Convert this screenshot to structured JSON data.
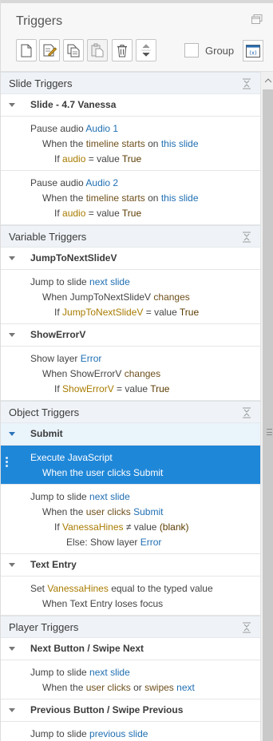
{
  "panel": {
    "title": "Triggers",
    "group_label": "Group"
  },
  "icons": {
    "toolbar": [
      "new-trigger-icon",
      "edit-trigger-icon",
      "copy-icon",
      "paste-icon",
      "delete-icon",
      "move-up-down-icon"
    ],
    "variables": "variables-icon",
    "restore": "restore-window-icon",
    "collapse": "collapse-all-icon"
  },
  "sections": [
    {
      "label": "Slide Triggers",
      "objects": [
        {
          "label": "Slide - 4.7 Vanessa",
          "triggers": [
            {
              "action": "Pause audio",
              "target": "Audio 1",
              "when": "When the",
              "w_kw": "timeline",
              "w_mid": "starts",
              "w_on": "on",
              "w_tgt": "this slide",
              "if": "If",
              "if_var": "audio",
              "if_op": "= value",
              "if_val": "True"
            },
            {
              "action": "Pause audio",
              "target": "Audio 2",
              "when": "When the",
              "w_kw": "timeline",
              "w_mid": "starts",
              "w_on": "on",
              "w_tgt": "this slide",
              "if": "If",
              "if_var": "audio",
              "if_op": "= value",
              "if_val": "True"
            }
          ]
        }
      ]
    },
    {
      "label": "Variable Triggers",
      "objects": [
        {
          "label": "JumpToNextSlideV",
          "triggers": [
            {
              "action": "Jump to slide",
              "target": "next slide",
              "when": "When JumpToNextSlideV",
              "w_kw": "changes",
              "if": "If",
              "if_var": "JumpToNextSlideV",
              "if_op": "= value",
              "if_val": "True"
            }
          ]
        },
        {
          "label": "ShowErrorV",
          "triggers": [
            {
              "action": "Show layer",
              "target": "Error",
              "when": "When ShowErrorV",
              "w_kw": "changes",
              "if": "If",
              "if_var": "ShowErrorV",
              "if_op": "= value",
              "if_val": "True"
            }
          ]
        }
      ]
    },
    {
      "label": "Object Triggers",
      "objects": [
        {
          "label": "Submit",
          "triggers": [
            {
              "action": "Execute",
              "target": "JavaScript",
              "when": "When the user clicks Submit"
            },
            {
              "action": "Jump to slide",
              "target": "next slide",
              "when": "When the",
              "w_kw": "user",
              "w_mid": "clicks",
              "w_tgt": "Submit",
              "if": "If",
              "if_var": "VanessaHines",
              "if_op": "≠ value",
              "if_val": "(blank)",
              "else": "Else: Show layer",
              "else_tgt": "Error"
            }
          ]
        },
        {
          "label": "Text Entry",
          "triggers": [
            {
              "action": "Set",
              "target": "VanessaHines",
              "rest": "equal to the typed value",
              "when": "When Text Entry loses focus"
            }
          ]
        }
      ]
    },
    {
      "label": "Player Triggers",
      "objects": [
        {
          "label": "Next Button / Swipe Next",
          "triggers": [
            {
              "action": "Jump to slide",
              "target": "next slide",
              "when": "When the",
              "w_kw": "user",
              "w_mid": "clicks",
              "w_or": "or",
              "w_mid2": "swipes",
              "w_tgt": "next"
            }
          ]
        },
        {
          "label": "Previous Button / Swipe Previous",
          "triggers": [
            {
              "action": "Jump to slide",
              "target": "previous slide"
            }
          ]
        }
      ]
    }
  ]
}
